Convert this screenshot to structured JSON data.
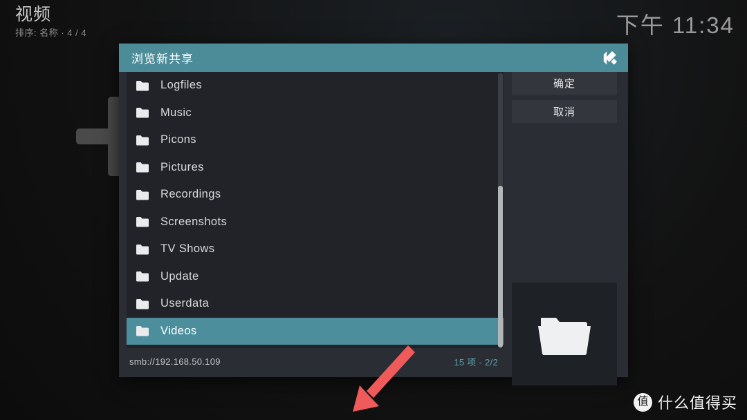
{
  "background": {
    "title": "视频",
    "subtitle": "排序: 名称  ·  4 / 4",
    "clock": "下午 11:34",
    "add_source_icon": "plus-icon"
  },
  "dialog": {
    "title": "浏览新共享",
    "logo_icon": "kodi-logo-icon",
    "footer": {
      "path": "smb://192.168.50.109",
      "count": "15 项 - 2/2"
    },
    "items": [
      {
        "label": "Logfiles",
        "selected": false
      },
      {
        "label": "Music",
        "selected": false
      },
      {
        "label": "Picons",
        "selected": false
      },
      {
        "label": "Pictures",
        "selected": false
      },
      {
        "label": "Recordings",
        "selected": false
      },
      {
        "label": "Screenshots",
        "selected": false
      },
      {
        "label": "TV Shows",
        "selected": false
      },
      {
        "label": "Update",
        "selected": false
      },
      {
        "label": "Userdata",
        "selected": false
      },
      {
        "label": "Videos",
        "selected": true
      }
    ],
    "buttons": {
      "ok": "确定",
      "cancel": "取消"
    },
    "preview_icon": "folder-open-icon",
    "scrollbar": {
      "thumb_top_percent": 41,
      "thumb_height_percent": 59
    }
  },
  "annotation": {
    "arrow_color": "#ef5a5a",
    "points_to": "Videos"
  },
  "watermark": {
    "badge": "值",
    "text": "什么值得买"
  },
  "colors": {
    "accent_teal": "#4c8c99",
    "selection_teal": "#4d8e9c",
    "dialog_bg": "#2a2d33",
    "list_bg": "#212328",
    "button_bg": "#33363c",
    "screen_bg": "#121212",
    "count_text": "#5aa3b2"
  }
}
